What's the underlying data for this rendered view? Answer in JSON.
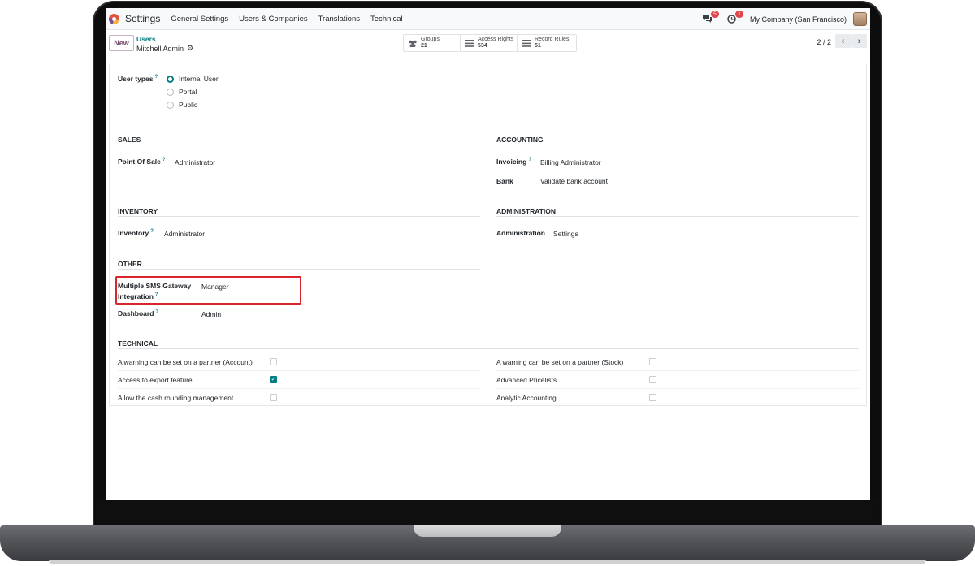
{
  "navbar": {
    "app_name": "Settings",
    "menu": [
      "General Settings",
      "Users & Companies",
      "Translations",
      "Technical"
    ],
    "messages_badge": "5",
    "activity_badge": "1",
    "company": "My Company (San Francisco)"
  },
  "control": {
    "new_label": "New",
    "breadcrumb_parent": "Users",
    "breadcrumb_current": "Mitchell Admin",
    "stats": [
      {
        "label": "Groups",
        "value": "21",
        "icon": "users-icon"
      },
      {
        "label": "Access Rights",
        "value": "534",
        "icon": "list-icon"
      },
      {
        "label": "Record Rules",
        "value": "51",
        "icon": "list-icon"
      }
    ],
    "pager": "2 / 2"
  },
  "form": {
    "user_types_label": "User types",
    "user_types_options": [
      "Internal User",
      "Portal",
      "Public"
    ],
    "user_types_selected": "Internal User",
    "sales": {
      "title": "SALES",
      "fields": [
        {
          "label": "Point Of Sale",
          "value": "Administrator"
        }
      ]
    },
    "accounting": {
      "title": "ACCOUNTING",
      "fields": [
        {
          "label": "Invoicing",
          "value": "Billing Administrator"
        },
        {
          "label": "Bank",
          "value": "Validate bank account"
        }
      ]
    },
    "inventory": {
      "title": "INVENTORY",
      "fields": [
        {
          "label": "Inventory",
          "value": "Administrator"
        }
      ]
    },
    "administration": {
      "title": "ADMINISTRATION",
      "fields": [
        {
          "label": "Administration",
          "value": "Settings"
        }
      ]
    },
    "other": {
      "title": "OTHER",
      "fields": [
        {
          "label_line1": "Multiple SMS Gateway",
          "label_line2": "Integration",
          "value": "Manager"
        },
        {
          "label": "Dashboard",
          "value": "Admin"
        }
      ]
    },
    "technical": {
      "title": "TECHNICAL",
      "left": [
        {
          "label": "A warning can be set on a partner (Account)",
          "checked": false
        },
        {
          "label": "Access to export feature",
          "checked": true
        },
        {
          "label": "Allow the cash rounding management",
          "checked": false
        }
      ],
      "right": [
        {
          "label": "A warning can be set on a partner (Stock)",
          "checked": false
        },
        {
          "label": "Advanced Pricelists",
          "checked": false
        },
        {
          "label": "Analytic Accounting",
          "checked": false
        }
      ]
    }
  },
  "colors": {
    "accent": "#017e84",
    "brand": "#714b67",
    "highlight": "#d9262c"
  }
}
